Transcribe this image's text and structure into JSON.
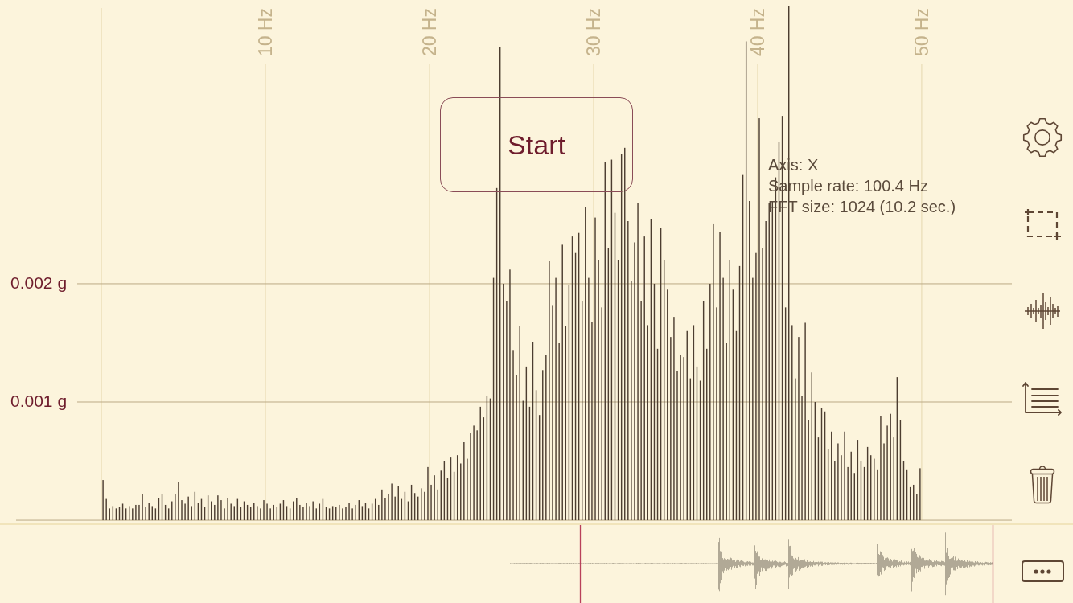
{
  "spectrum": {
    "chart_data": {
      "type": "bar",
      "x": [
        0.1,
        0.3,
        0.5,
        0.7,
        0.9,
        1.1,
        1.3,
        1.5,
        1.7,
        1.9,
        2.1,
        2.3,
        2.5,
        2.7,
        2.9,
        3.1,
        3.3,
        3.5,
        3.7,
        3.9,
        4.1,
        4.3,
        4.5,
        4.7,
        4.9,
        5.1,
        5.3,
        5.5,
        5.7,
        5.9,
        6.1,
        6.3,
        6.5,
        6.7,
        6.9,
        7.1,
        7.3,
        7.5,
        7.7,
        7.9,
        8.1,
        8.3,
        8.5,
        8.7,
        8.9,
        9.1,
        9.3,
        9.5,
        9.7,
        9.9,
        10.1,
        10.3,
        10.5,
        10.7,
        10.9,
        11.1,
        11.3,
        11.5,
        11.7,
        11.9,
        12.1,
        12.3,
        12.5,
        12.7,
        12.9,
        13.1,
        13.3,
        13.5,
        13.7,
        13.9,
        14.1,
        14.3,
        14.5,
        14.7,
        14.9,
        15.1,
        15.3,
        15.5,
        15.7,
        15.9,
        16.1,
        16.3,
        16.5,
        16.7,
        16.9,
        17.1,
        17.3,
        17.5,
        17.7,
        17.9,
        18.1,
        18.3,
        18.5,
        18.7,
        18.9,
        19.1,
        19.3,
        19.5,
        19.7,
        19.9,
        20.1,
        20.3,
        20.5,
        20.7,
        20.9,
        21.1,
        21.3,
        21.5,
        21.7,
        21.9,
        22.1,
        22.3,
        22.5,
        22.7,
        22.9,
        23.1,
        23.3,
        23.5,
        23.7,
        23.9,
        24.1,
        24.3,
        24.5,
        24.7,
        24.9,
        25.1,
        25.3,
        25.5,
        25.7,
        25.9,
        26.1,
        26.3,
        26.5,
        26.7,
        26.9,
        27.1,
        27.3,
        27.5,
        27.7,
        27.9,
        28.1,
        28.3,
        28.5,
        28.7,
        28.9,
        29.1,
        29.3,
        29.5,
        29.7,
        29.9,
        30.1,
        30.3,
        30.5,
        30.7,
        30.9,
        31.1,
        31.3,
        31.5,
        31.7,
        31.9,
        32.1,
        32.3,
        32.5,
        32.7,
        32.9,
        33.1,
        33.3,
        33.5,
        33.7,
        33.9,
        34.1,
        34.3,
        34.5,
        34.7,
        34.9,
        35.1,
        35.3,
        35.5,
        35.7,
        35.9,
        36.1,
        36.3,
        36.5,
        36.7,
        36.9,
        37.1,
        37.3,
        37.5,
        37.7,
        37.9,
        38.1,
        38.3,
        38.5,
        38.7,
        38.9,
        39.1,
        39.3,
        39.5,
        39.7,
        39.9,
        40.1,
        40.3,
        40.5,
        40.7,
        40.9,
        41.1,
        41.3,
        41.5,
        41.7,
        41.9,
        42.1,
        42.3,
        42.5,
        42.7,
        42.9,
        43.1,
        43.3,
        43.5,
        43.7,
        43.9,
        44.1,
        44.3,
        44.5,
        44.7,
        44.9,
        45.1,
        45.3,
        45.5,
        45.7,
        45.9,
        46.1,
        46.3,
        46.5,
        46.7,
        46.9,
        47.1,
        47.3,
        47.5,
        47.7,
        47.9,
        48.1,
        48.3,
        48.5,
        48.7,
        48.9,
        49.1,
        49.3,
        49.5,
        49.7,
        49.9
      ],
      "values": [
        0.00034,
        0.00018,
        0.0001,
        0.00012,
        0.0001,
        0.00011,
        0.00014,
        0.0001,
        0.00012,
        0.0001,
        0.00013,
        0.00013,
        0.00022,
        0.00011,
        0.00015,
        0.00012,
        0.0001,
        0.00019,
        0.00022,
        0.00013,
        0.0001,
        0.00016,
        0.00022,
        0.00032,
        0.00017,
        0.00014,
        0.0002,
        0.00012,
        0.00024,
        0.00015,
        0.00018,
        0.00011,
        0.00021,
        0.00016,
        0.00013,
        0.00021,
        0.00017,
        0.0001,
        0.00019,
        0.00014,
        0.00012,
        0.00018,
        0.00011,
        0.00016,
        0.00013,
        0.00011,
        0.00015,
        0.00012,
        0.0001,
        0.00017,
        0.00014,
        0.0001,
        0.00013,
        0.00011,
        0.00014,
        0.00017,
        0.00012,
        0.0001,
        0.00016,
        0.00019,
        0.00013,
        0.00011,
        0.00015,
        0.00012,
        0.00016,
        0.0001,
        0.00014,
        0.00018,
        0.00011,
        0.0001,
        0.00012,
        0.00011,
        0.00013,
        0.0001,
        0.00011,
        0.00015,
        0.0001,
        0.00013,
        0.00017,
        0.00012,
        0.00015,
        0.0001,
        0.00014,
        0.00018,
        0.00013,
        0.00026,
        0.00019,
        0.00022,
        0.00031,
        0.0002,
        0.00029,
        0.00018,
        0.00024,
        0.00016,
        0.0003,
        0.00023,
        0.0002,
        0.00027,
        0.00024,
        0.00045,
        0.0003,
        0.00038,
        0.00026,
        0.00042,
        0.0005,
        0.00036,
        0.00053,
        0.00041,
        0.00055,
        0.00048,
        0.00066,
        0.00052,
        0.00074,
        0.0008,
        0.00076,
        0.00096,
        0.00087,
        0.00105,
        0.00103,
        0.00205,
        0.00281,
        0.004,
        0.002,
        0.00185,
        0.00212,
        0.00144,
        0.00123,
        0.00164,
        0.00101,
        0.0013,
        0.00096,
        0.00151,
        0.0011,
        0.00089,
        0.00127,
        0.0014,
        0.00219,
        0.00182,
        0.00205,
        0.0015,
        0.00233,
        0.00164,
        0.00199,
        0.0024,
        0.00226,
        0.00243,
        0.00185,
        0.00265,
        0.00205,
        0.00168,
        0.00256,
        0.0022,
        0.0018,
        0.00303,
        0.0023,
        0.00305,
        0.0026,
        0.0022,
        0.0031,
        0.00315,
        0.00253,
        0.00202,
        0.00235,
        0.00268,
        0.00185,
        0.0024,
        0.00165,
        0.00255,
        0.002,
        0.00145,
        0.00247,
        0.0022,
        0.00195,
        0.00155,
        0.00172,
        0.00126,
        0.0014,
        0.00138,
        0.0016,
        0.0012,
        0.00165,
        0.0013,
        0.00118,
        0.00185,
        0.00145,
        0.002,
        0.00251,
        0.0018,
        0.00244,
        0.00205,
        0.0015,
        0.0022,
        0.00195,
        0.0016,
        0.00215,
        0.00292,
        0.00405,
        0.0027,
        0.00205,
        0.00226,
        0.0034,
        0.0023,
        0.00253,
        0.00268,
        0.0027,
        0.0029,
        0.0032,
        0.00342,
        0.0018,
        0.00435,
        0.00165,
        0.0012,
        0.00155,
        0.00105,
        0.00167,
        0.00085,
        0.00125,
        0.001,
        0.0007,
        0.00095,
        0.00092,
        0.0006,
        0.00075,
        0.0005,
        0.00065,
        0.00055,
        0.00075,
        0.00045,
        0.00058,
        0.0004,
        0.00068,
        0.0005,
        0.00045,
        0.00062,
        0.00055,
        0.00052,
        0.00043,
        0.00088,
        0.00065,
        0.0008,
        0.0009,
        0.0007,
        0.00121,
        0.00085,
        0.0005,
        0.00043,
        0.00028,
        0.0003,
        0.00022,
        0.00044
      ],
      "xlim": [
        -6.18,
        59.22
      ],
      "ylim": [
        -0.0007,
        0.0044
      ],
      "xticks": [
        {
          "value": 10,
          "label": "10 Hz"
        },
        {
          "value": 20,
          "label": "20 Hz"
        },
        {
          "value": 30,
          "label": "30 Hz"
        },
        {
          "value": 40,
          "label": "40 Hz"
        },
        {
          "value": 50,
          "label": "50 Hz"
        }
      ],
      "yticks": [
        {
          "value": 0.001,
          "label": "0.001 g"
        },
        {
          "value": 0.002,
          "label": "0.002 g"
        }
      ],
      "grid": true
    }
  },
  "start_button": {
    "label": "Start"
  },
  "info": [
    "Axis: X",
    "Sample rate: 100.4 Hz",
    "FFT size: 1024 (10.2 sec.)"
  ]
}
